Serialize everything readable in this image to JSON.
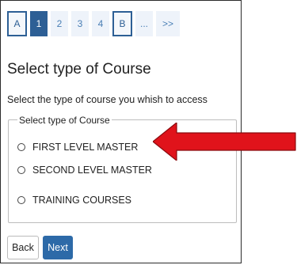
{
  "pagination": {
    "items": [
      {
        "label": "A"
      },
      {
        "label": "1"
      },
      {
        "label": "2"
      },
      {
        "label": "3"
      },
      {
        "label": "4"
      },
      {
        "label": "B"
      },
      {
        "label": "..."
      },
      {
        "label": ">>"
      }
    ]
  },
  "page": {
    "title": "Select type of Course",
    "subtitle": "Select the type of course you whish to access"
  },
  "course_group": {
    "legend": "Select type of Course",
    "options": [
      {
        "label": "FIRST LEVEL MASTER"
      },
      {
        "label": "SECOND LEVEL MASTER"
      },
      {
        "label": "TRAINING COURSES"
      }
    ]
  },
  "buttons": {
    "back": "Back",
    "next": "Next"
  },
  "colors": {
    "accent": "#2d5f95",
    "arrow_red": "#e0131b"
  }
}
